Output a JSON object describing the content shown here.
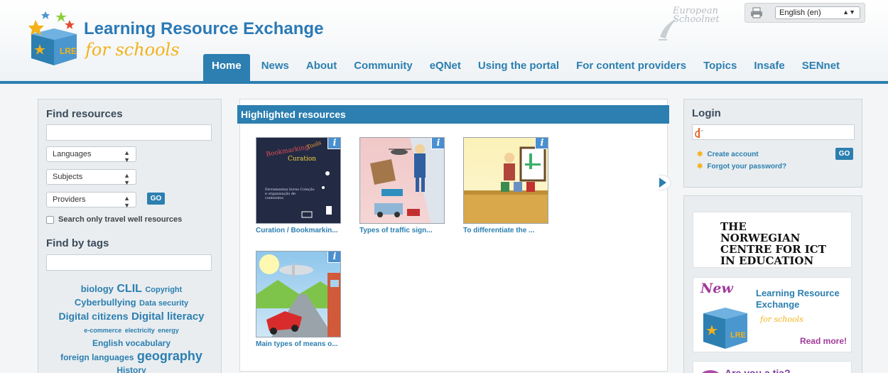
{
  "header": {
    "logo_title": "Learning Resource Exchange",
    "logo_subtitle": "for schools",
    "logo_box_text": "LRE",
    "partner_logo_text": "European Schoolnet",
    "language_select": "English (en)"
  },
  "nav": {
    "items": [
      {
        "label": "Home",
        "active": true
      },
      {
        "label": "News"
      },
      {
        "label": "About"
      },
      {
        "label": "Community"
      },
      {
        "label": "eQNet"
      },
      {
        "label": "Using the portal"
      },
      {
        "label": "For content providers"
      },
      {
        "label": "Topics"
      },
      {
        "label": "Insafe"
      },
      {
        "label": "SENnet"
      }
    ]
  },
  "find_resources": {
    "heading": "Find resources",
    "search_value": "",
    "languages_select": "Languages",
    "subjects_select": "Subjects",
    "providers_select": "Providers",
    "go_label": "GO",
    "travel_well_label": "Search only travel well resources",
    "tags_heading": "Find by tags",
    "tags_search_value": "",
    "tags": [
      {
        "label": "biology",
        "size": 13
      },
      {
        "label": "CLIL",
        "size": 16
      },
      {
        "label": "Copyright",
        "size": 11
      },
      {
        "label": "Cyberbullying",
        "size": 13
      },
      {
        "label": "Data security",
        "size": 11
      },
      {
        "label": "Digital citizens",
        "size": 14
      },
      {
        "label": "Digital literacy",
        "size": 15
      },
      {
        "label": "e-commerce",
        "size": 9
      },
      {
        "label": "electricity",
        "size": 9
      },
      {
        "label": "energy",
        "size": 9
      },
      {
        "label": "English vocabulary",
        "size": 12
      },
      {
        "label": "foreign languages",
        "size": 12
      },
      {
        "label": "geography",
        "size": 18
      },
      {
        "label": "History",
        "size": 12
      }
    ]
  },
  "highlighted": {
    "heading": "Highlighted resources",
    "info_icon_label": "i",
    "resources": [
      {
        "label": "Curation / Bookmarkin...",
        "thumb_caption_1": "Bookmarking",
        "thumb_caption_2": "Curation",
        "thumb_caption_3": "Tools",
        "thumb_body": "Ferramentas livres Coleção e organização de conteúdos"
      },
      {
        "label": "Types of traffic sign..."
      },
      {
        "label": "To differentiate the ..."
      },
      {
        "label": "Main types of means o..."
      }
    ]
  },
  "login": {
    "heading": "Login",
    "username_value": "",
    "go_label": "GO",
    "create_account": "Create account",
    "forgot_password": "Forgot your password?"
  },
  "ads": {
    "norwegian_text": "THE NORWEGIAN CENTRE FOR ICT IN EDUCATION",
    "new_badge": "New",
    "lre_title": "Learning Resource Exchange",
    "lre_subtitle": "for schools",
    "read_more": "Read more!",
    "third_ad_text": "Are you a tia?"
  },
  "colors": {
    "brand_blue": "#2c7fb0",
    "brand_yellow": "#f3b21a",
    "brand_purple": "#a13a9b"
  }
}
